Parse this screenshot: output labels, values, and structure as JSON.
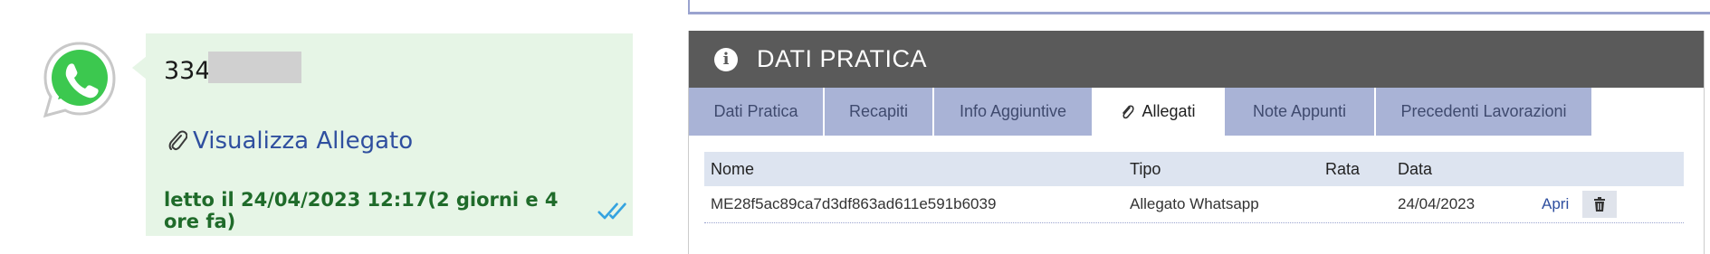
{
  "message": {
    "phone_prefix": "334",
    "attachment_label": "Visualizza Allegato",
    "read_status": "letto il 24/04/2023 12:17(2 giorni e 4 ore fa)"
  },
  "panel": {
    "title": "DATI PRATICA",
    "tabs": [
      {
        "label": "Dati Pratica"
      },
      {
        "label": "Recapiti"
      },
      {
        "label": "Info Aggiuntive"
      },
      {
        "label": "Allegati"
      },
      {
        "label": "Note Appunti"
      },
      {
        "label": "Precedenti Lavorazioni"
      }
    ],
    "active_tab": "Allegati",
    "table": {
      "headers": [
        "Nome",
        "Tipo",
        "Rata",
        "Data"
      ],
      "rows": [
        {
          "nome": "ME28f5ac89ca7d3df863ad611e591b6039",
          "tipo": "Allegato Whatsapp",
          "rata": "",
          "data": "24/04/2023",
          "action": "Apri"
        }
      ]
    }
  },
  "colors": {
    "bubble_bg": "#e6f5e6",
    "header_bg": "#5a5a5a",
    "tab_bg": "#a9b3d6",
    "link": "#2f4f9f",
    "read_text": "#1f6b2a",
    "read_ticks": "#34a3e0"
  },
  "icons": {
    "app_logo": "whatsapp-icon",
    "attachment": "paperclip-icon",
    "read": "double-check-icon",
    "info": "info-icon",
    "delete": "trash-icon"
  }
}
